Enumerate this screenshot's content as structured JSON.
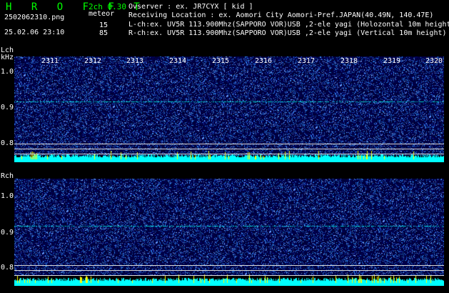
{
  "header": {
    "title": "H R O F F T",
    "version": "2ch 0.30",
    "filename": "2502062310.png",
    "datetime": "25.02.06 23:10",
    "meteor_label": "meteor",
    "lch_count": "15",
    "rch_count": "85"
  },
  "info": {
    "observer": "Ovserver              : ex. JR7CYX [ kid ]",
    "location": "Receiving Location : ex. Aomori City Aomori-Pref.JAPAN(40.49N, 140.47E)",
    "lch": "L-ch:ex. UV5R 113.900Mhz(SAPPORO VOR)USB ,2-ele yagi (Holozontal 10m height)",
    "rch": "R-ch:ex. UV5R 113.900Mhz(SAPPORO VOR)USB ,2-ele yagi (Vertical 10m height)"
  },
  "lch_panel": {
    "label": "Lch",
    "unit": "kHz",
    "yticks": [
      "1.0",
      "0.9",
      "0.8"
    ],
    "xticks": [
      "2311",
      "2312",
      "2313",
      "2314",
      "2315",
      "2316",
      "2317",
      "2318",
      "2319",
      "2320"
    ]
  },
  "rch_panel": {
    "label": "Rch",
    "yticks": [
      "1.0",
      "0.9",
      "0.8"
    ]
  },
  "colors": {
    "background": "#000000",
    "title": "#00ff00",
    "noise_dark": "#000060",
    "noise_light": "#2a5fff",
    "carrier": "#00d0d0",
    "level_cyan": "#00ffff",
    "level_peak": "#ffff00"
  }
}
